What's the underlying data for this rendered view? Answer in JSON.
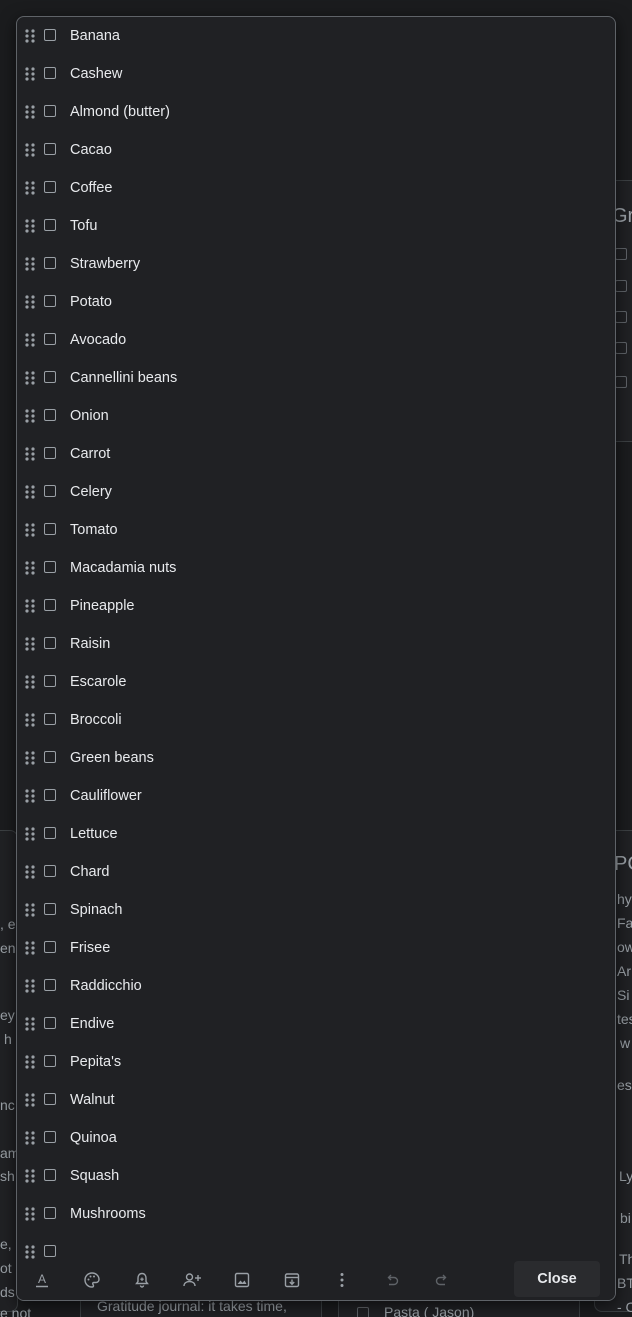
{
  "background": {
    "left_snippets": [
      ",  e",
      "en",
      "ey",
      "h",
      "nc",
      "am",
      "sh",
      "e, r",
      "ot",
      "ds",
      "e not"
    ],
    "right_snippets": [
      "Gr",
      "PC",
      "hy",
      "Fa",
      "ow",
      "Ar",
      "Si",
      "tes",
      "w",
      "es",
      "Ly",
      "bi",
      "Th",
      "BT",
      "- Cl"
    ],
    "bottom_snippets": [
      "Gratitude journal: it takes time,",
      "Pasta ( Jason)"
    ]
  },
  "checklist": {
    "items": [
      "Banana",
      "Cashew",
      "Almond (butter)",
      "Cacao",
      "Coffee",
      "Tofu",
      "Strawberry",
      "Potato",
      "Avocado",
      "Cannellini beans",
      "Onion",
      "Carrot",
      "Celery",
      "Tomato",
      "Macadamia nuts",
      "Pineapple",
      "Raisin",
      "Escarole",
      "Broccoli",
      "Green beans",
      "Cauliflower",
      "Lettuce",
      "Chard",
      "Spinach",
      "Frisee",
      "Raddicchio",
      "Endive",
      "Pepita's",
      "Walnut",
      "Quinoa",
      "Squash",
      "Mushrooms",
      ""
    ]
  },
  "toolbar": {
    "tools": [
      {
        "name": "text-format-icon"
      },
      {
        "name": "palette-icon"
      },
      {
        "name": "reminder-bell-icon"
      },
      {
        "name": "collaborator-icon"
      },
      {
        "name": "image-icon"
      },
      {
        "name": "archive-icon"
      },
      {
        "name": "more-vert-icon"
      },
      {
        "name": "undo-icon"
      },
      {
        "name": "redo-icon"
      }
    ],
    "close_label": "Close"
  },
  "colors": {
    "background": "#202124",
    "text": "#e8eaed",
    "border": "#5f6368",
    "icon": "#9aa0a6"
  }
}
